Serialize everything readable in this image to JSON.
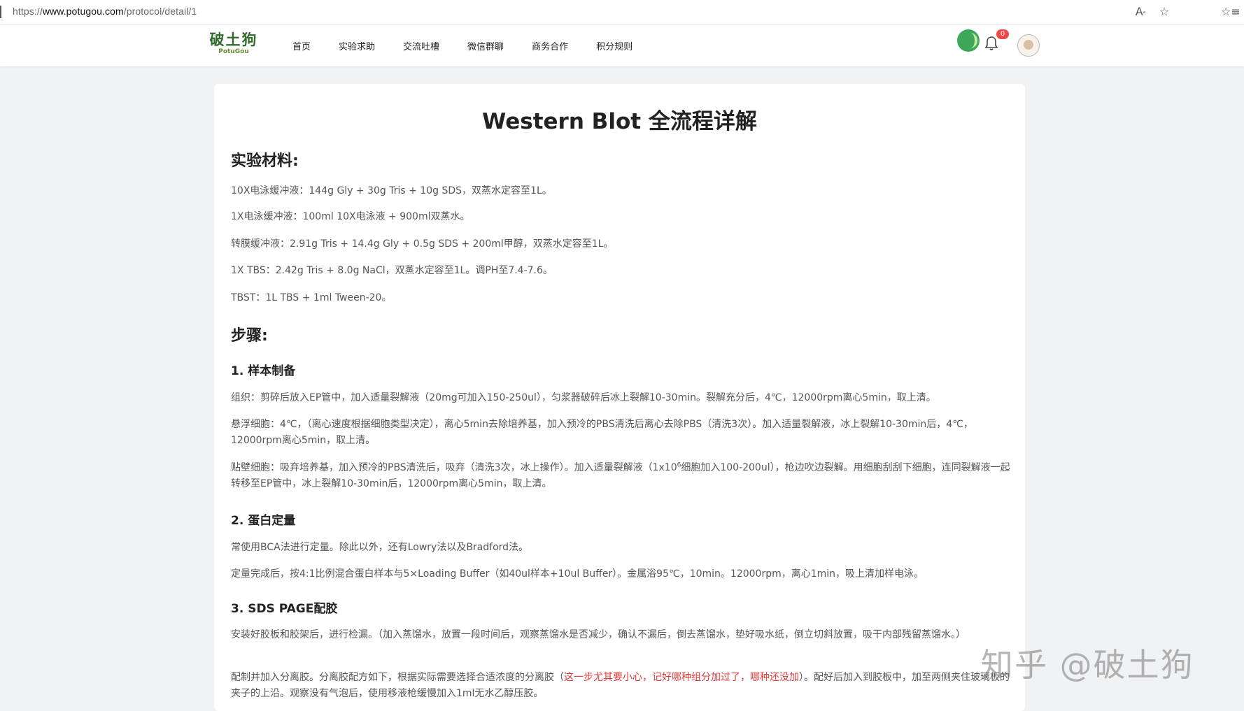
{
  "browser": {
    "url_prefix": "https://",
    "url_host": "www.potugou.com",
    "url_path": "/protocol/detail/1",
    "icons": [
      "read-aloud-icon",
      "favorite-star-icon",
      "favorites-list-icon"
    ]
  },
  "header": {
    "logo_cn": "破土狗",
    "logo_en": "PotuGou",
    "menu": [
      "首页",
      "实验求助",
      "交流吐槽",
      "微信群聊",
      "商务合作",
      "积分规则"
    ],
    "notification_count": "0"
  },
  "article": {
    "title": "Western Blot 全流程详解",
    "materials_heading": "实验材料:",
    "materials": [
      "10X电泳缓冲液：144g Gly + 30g Tris + 10g SDS，双蒸水定容至1L。",
      "1X电泳缓冲液：100ml 10X电泳液 + 900ml双蒸水。",
      "转膜缓冲液：2.91g Tris + 14.4g Gly + 0.5g SDS + 200ml甲醇，双蒸水定容至1L。",
      "1X TBS：2.42g Tris + 8.0g NaCl，双蒸水定容至1L。调PH至7.4-7.6。",
      "TBST：1L TBS + 1ml Tween-20。"
    ],
    "steps_heading": "步骤:",
    "s1_heading": "1. 样本制备",
    "s1_p1": "组织：剪碎后放入EP管中，加入适量裂解液（20mg可加入150-250ul），匀浆器破碎后冰上裂解10-30min。裂解充分后，4℃，12000rpm离心5min，取上清。",
    "s1_p2": "悬浮细胞：4℃，（离心速度根据细胞类型决定），离心5min去除培养基，加入预冷的PBS清洗后离心去除PBS（清洗3次）。加入适量裂解液，冰上裂解10-30min后，4℃，12000rpm离心5min，取上清。",
    "s1_p3a": "贴壁细胞：吸弃培养基，加入预冷的PBS清洗后，吸弃（清洗3次，冰上操作）。加入适量裂解液（1x10",
    "s1_p3_sup": "6",
    "s1_p3b": "细胞加入100-200ul），枪边吹边裂解。用细胞刮刮下细胞，连同裂解液一起转移至EP管中，冰上裂解10-30min后，12000rpm离心5min，取上清。",
    "s2_heading": "2. 蛋白定量",
    "s2_p1": "常使用BCA法进行定量。除此以外，还有Lowry法以及Bradford法。",
    "s2_p2": "定量完成后，按4:1比例混合蛋白样本与5×Loading Buffer（如40ul样本+10ul Buffer）。金属浴95℃，10min。12000rpm，离心1min，吸上清加样电泳。",
    "s3_heading": "3. SDS PAGE配胶",
    "s3_p1": "安装好胶板和胶架后，进行检漏。（加入蒸馏水，放置一段时间后，观察蒸馏水是否减少，确认不漏后，倒去蒸馏水，垫好吸水纸，倒立切斜放置，吸干内部残留蒸馏水。）",
    "s3_p2a": "配制并加入分离胶。分离胶配方如下，根据实际需要选择合适浓度的分离胶（",
    "s3_p2_red": "这一步尤其要小心，记好哪种组分加过了，哪种还没加",
    "s3_p2b": "）。配好后加入到胶板中，加至两侧夹住玻璃板的夹子的上沿。观察没有气泡后，使用移液枪缓慢加入1ml无水乙醇压胶。",
    "highlight_color": "#e03b3b"
  },
  "watermark": "知乎 @破土狗"
}
